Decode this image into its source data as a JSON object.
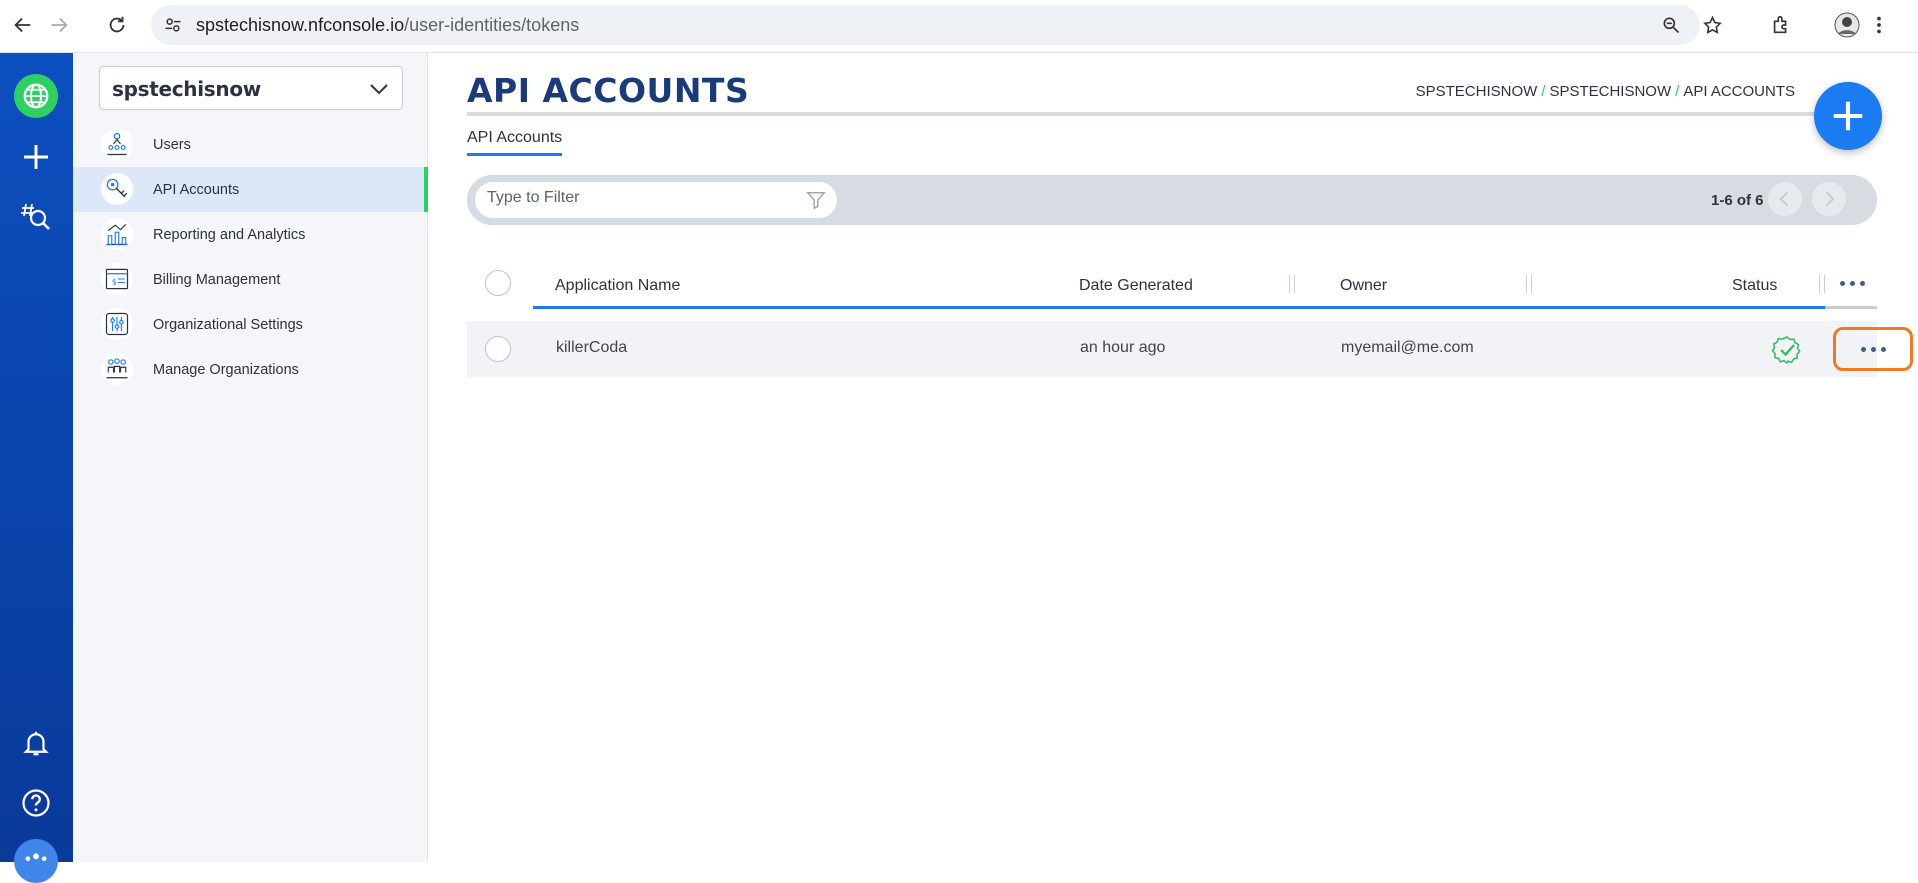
{
  "browser": {
    "url_host": "spstechisnow.nfconsole.io",
    "url_path": "/user-identities/tokens"
  },
  "rail": {
    "icons": [
      "globe-icon",
      "plus-icon",
      "hashtag-search-icon",
      "bell-icon",
      "help-icon",
      "people-icon"
    ]
  },
  "sidebar": {
    "org_name": "spstechisnow",
    "items": [
      {
        "label": "Users",
        "icon": "users-icon"
      },
      {
        "label": "API Accounts",
        "icon": "api-keys-icon"
      },
      {
        "label": "Reporting and Analytics",
        "icon": "analytics-icon"
      },
      {
        "label": "Billing Management",
        "icon": "billing-icon"
      },
      {
        "label": "Organizational Settings",
        "icon": "settings-sliders-icon"
      },
      {
        "label": "Manage Organizations",
        "icon": "organizations-icon"
      }
    ]
  },
  "main": {
    "title": "API ACCOUNTS",
    "breadcrumb": [
      "SPSTECHISNOW",
      "SPSTECHISNOW",
      "API ACCOUNTS"
    ],
    "tab_label": "API Accounts",
    "filter_placeholder": "Type to Filter",
    "pager_text": "1-6 of 6"
  },
  "table": {
    "columns": [
      "Application Name",
      "Date Generated",
      "Owner",
      "Status"
    ],
    "rows": [
      {
        "application_name": "killerCoda",
        "date_generated": "an hour ago",
        "owner": "myemail@me.com",
        "status": "active"
      }
    ]
  },
  "colors": {
    "rail": "#0c4fbf",
    "accent_green": "#2ecf63",
    "accent_blue": "#1a7cf0",
    "title_navy": "#1b3b78",
    "highlight_orange": "#f07a24"
  }
}
